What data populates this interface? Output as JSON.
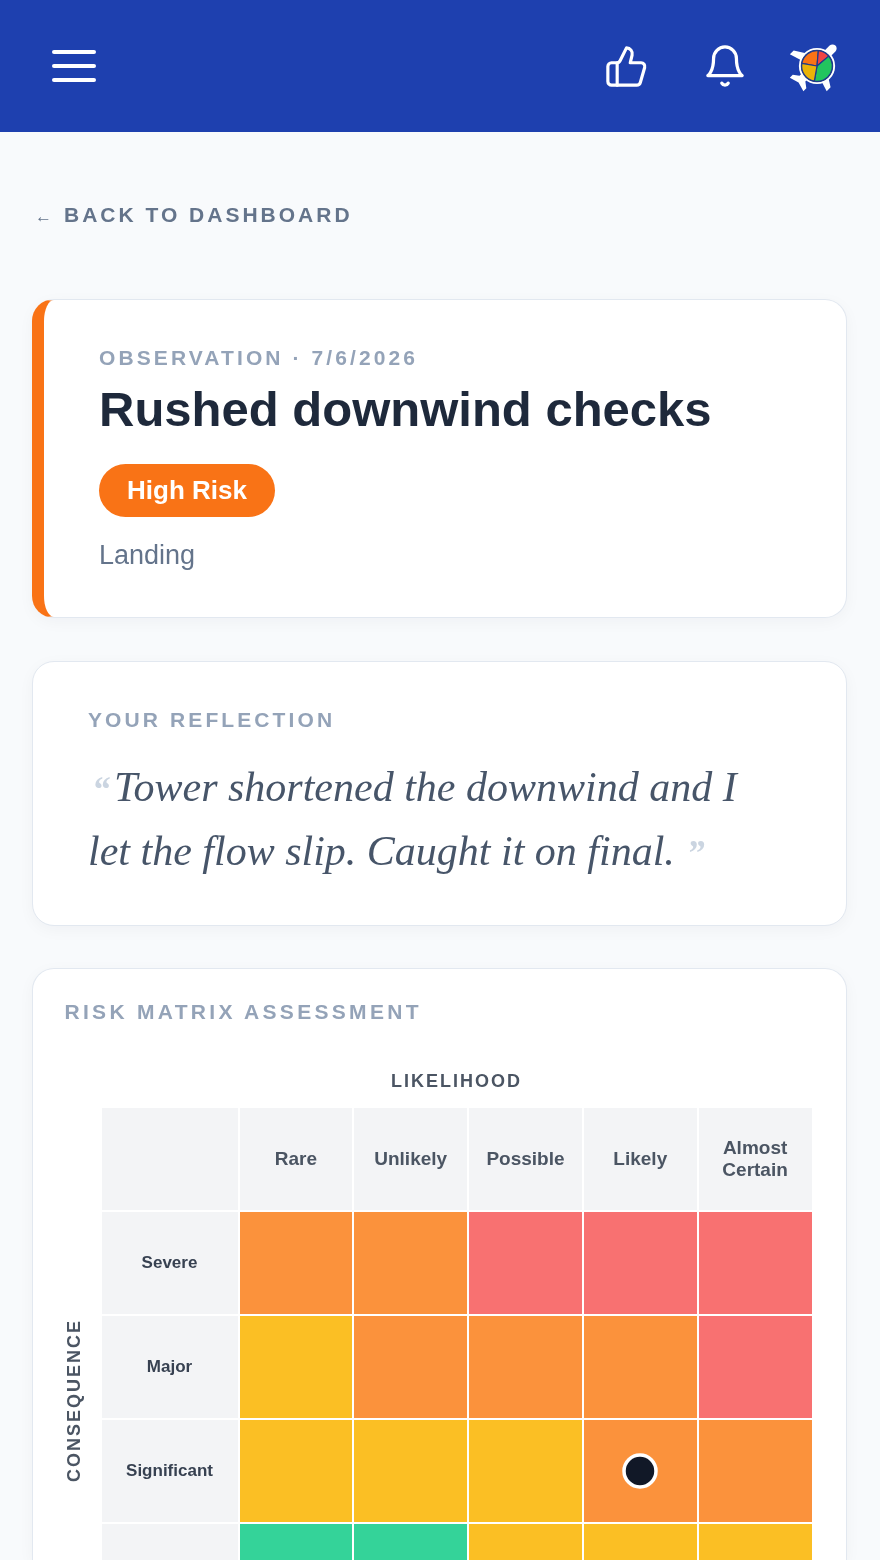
{
  "back_link": {
    "arrow": "←",
    "label": "BACK TO DASHBOARD"
  },
  "observation": {
    "overline": "OBSERVATION · 7/6/2026",
    "title": "Rushed downwind checks",
    "badge": "High Risk",
    "category": "Landing"
  },
  "reflection": {
    "heading": "YOUR REFLECTION",
    "open_mark": "“",
    "text": "Tower shortened the downwind and I let the flow slip. Caught it on final.",
    "close_mark": "”"
  },
  "risk_matrix": {
    "heading": "RISK MATRIX ASSESSMENT",
    "x_axis_label": "LIKELIHOOD",
    "y_axis_label": "CONSEQUENCE",
    "columns": [
      "Rare",
      "Unlikely",
      "Possible",
      "Likely",
      "Almost Certain"
    ],
    "rows": [
      {
        "label": "Severe",
        "cells": [
          {
            "color": "#fb923c",
            "selected": false
          },
          {
            "color": "#fb923c",
            "selected": false
          },
          {
            "color": "#f87171",
            "selected": false
          },
          {
            "color": "#f87171",
            "selected": false
          },
          {
            "color": "#f87171",
            "selected": false
          }
        ]
      },
      {
        "label": "Major",
        "cells": [
          {
            "color": "#fbbf24",
            "selected": false
          },
          {
            "color": "#fb923c",
            "selected": false
          },
          {
            "color": "#fb923c",
            "selected": false
          },
          {
            "color": "#fb923c",
            "selected": false
          },
          {
            "color": "#f87171",
            "selected": false
          }
        ]
      },
      {
        "label": "Significant",
        "cells": [
          {
            "color": "#fbbf24",
            "selected": false
          },
          {
            "color": "#fbbf24",
            "selected": false
          },
          {
            "color": "#fbbf24",
            "selected": false
          },
          {
            "color": "#fb923c",
            "selected": true
          },
          {
            "color": "#fb923c",
            "selected": false
          }
        ]
      },
      {
        "cells": [
          {
            "color": "#34d399"
          },
          {
            "color": "#34d399"
          },
          {
            "color": "#fbbf24"
          },
          {
            "color": "#fbbf24"
          },
          {
            "color": "#fbbf24"
          }
        ]
      }
    ]
  }
}
